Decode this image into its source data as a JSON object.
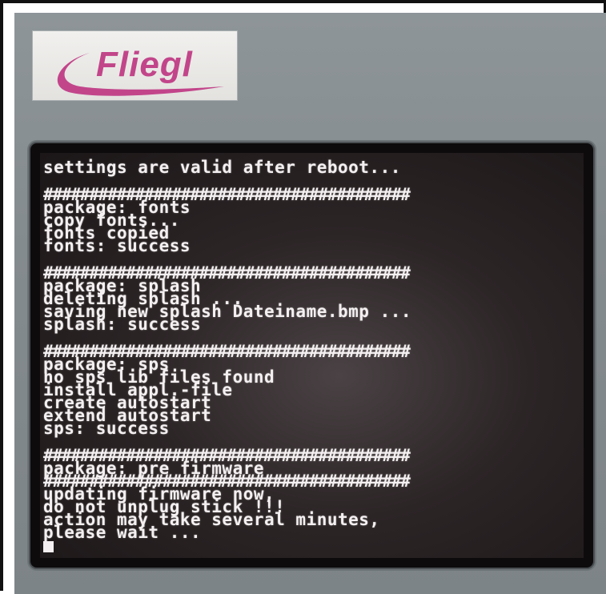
{
  "logo": {
    "text": "Fliegl",
    "color": "#c2458a",
    "icon": "swoosh-icon"
  },
  "console": {
    "text_color": "#f4eff0",
    "lines": [
      "settings are valid after reboot...",
      "",
      "########################################",
      "package: fonts",
      "copy fonts...",
      "fonts copied",
      "fonts: success",
      "",
      "########################################",
      "package: splash",
      "deleting splash ...",
      "saving new splash Dateiname.bmp ...",
      "splash: success",
      "",
      "########################################",
      "package: sps",
      "no sps lib files found",
      "install appl.-file",
      "create autostart",
      "extend autostart",
      "sps: success",
      "",
      "########################################",
      "package: pre firmware",
      "########################################",
      "updating firmware now,",
      "do not unplug stick !!!",
      "action may take several minutes,",
      "please wait ..."
    ]
  }
}
